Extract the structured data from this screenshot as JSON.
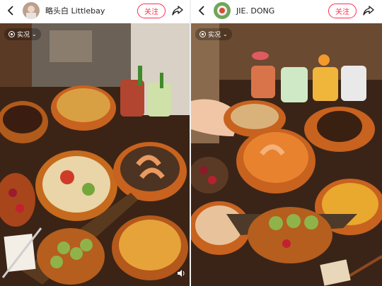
{
  "left_post": {
    "username": "略头白 Littlebay",
    "follow_label": "关注",
    "tag_label": "实况",
    "tag_chevron": "⌄"
  },
  "right_post": {
    "username": "JIE. DONG",
    "follow_label": "关注",
    "tag_label": "实况",
    "tag_chevron": "⌄"
  },
  "icons": {
    "back": "back-arrow-icon",
    "share": "share-icon",
    "live": "live-photo-icon",
    "sound": "speaker-icon"
  },
  "colors": {
    "accent": "#ff2e4d",
    "table": "#3a2418",
    "bowl": "#c8621f"
  }
}
